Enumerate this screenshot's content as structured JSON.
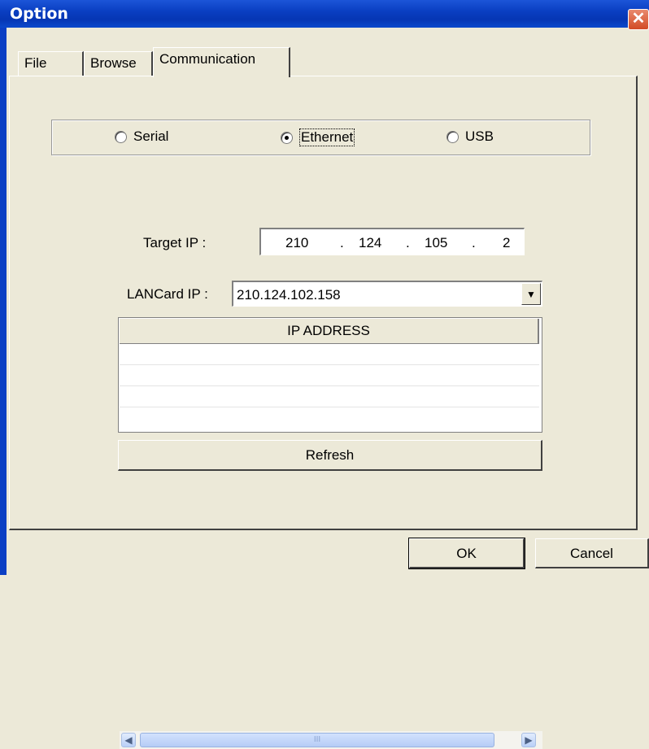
{
  "window": {
    "title": "Option"
  },
  "tabs": [
    "File",
    "Browse",
    "Communication"
  ],
  "connection": {
    "options": [
      "Serial",
      "Ethernet",
      "USB"
    ],
    "selected": "Ethernet"
  },
  "target_ip": {
    "label": "Target IP :",
    "octets": [
      "210",
      "124",
      "105",
      "2"
    ],
    "separator": "."
  },
  "lancard_ip": {
    "label": "LANCard IP :",
    "value": "210.124.102.158"
  },
  "ip_list": {
    "header": "IP ADDRESS",
    "scroll_thumb_label": "III"
  },
  "buttons": {
    "refresh": "Refresh",
    "ok": "OK",
    "cancel": "Cancel"
  },
  "colors": {
    "titlebar": "#0a3fc2",
    "dialog_bg": "#ece9d8",
    "close": "#d24b25"
  }
}
